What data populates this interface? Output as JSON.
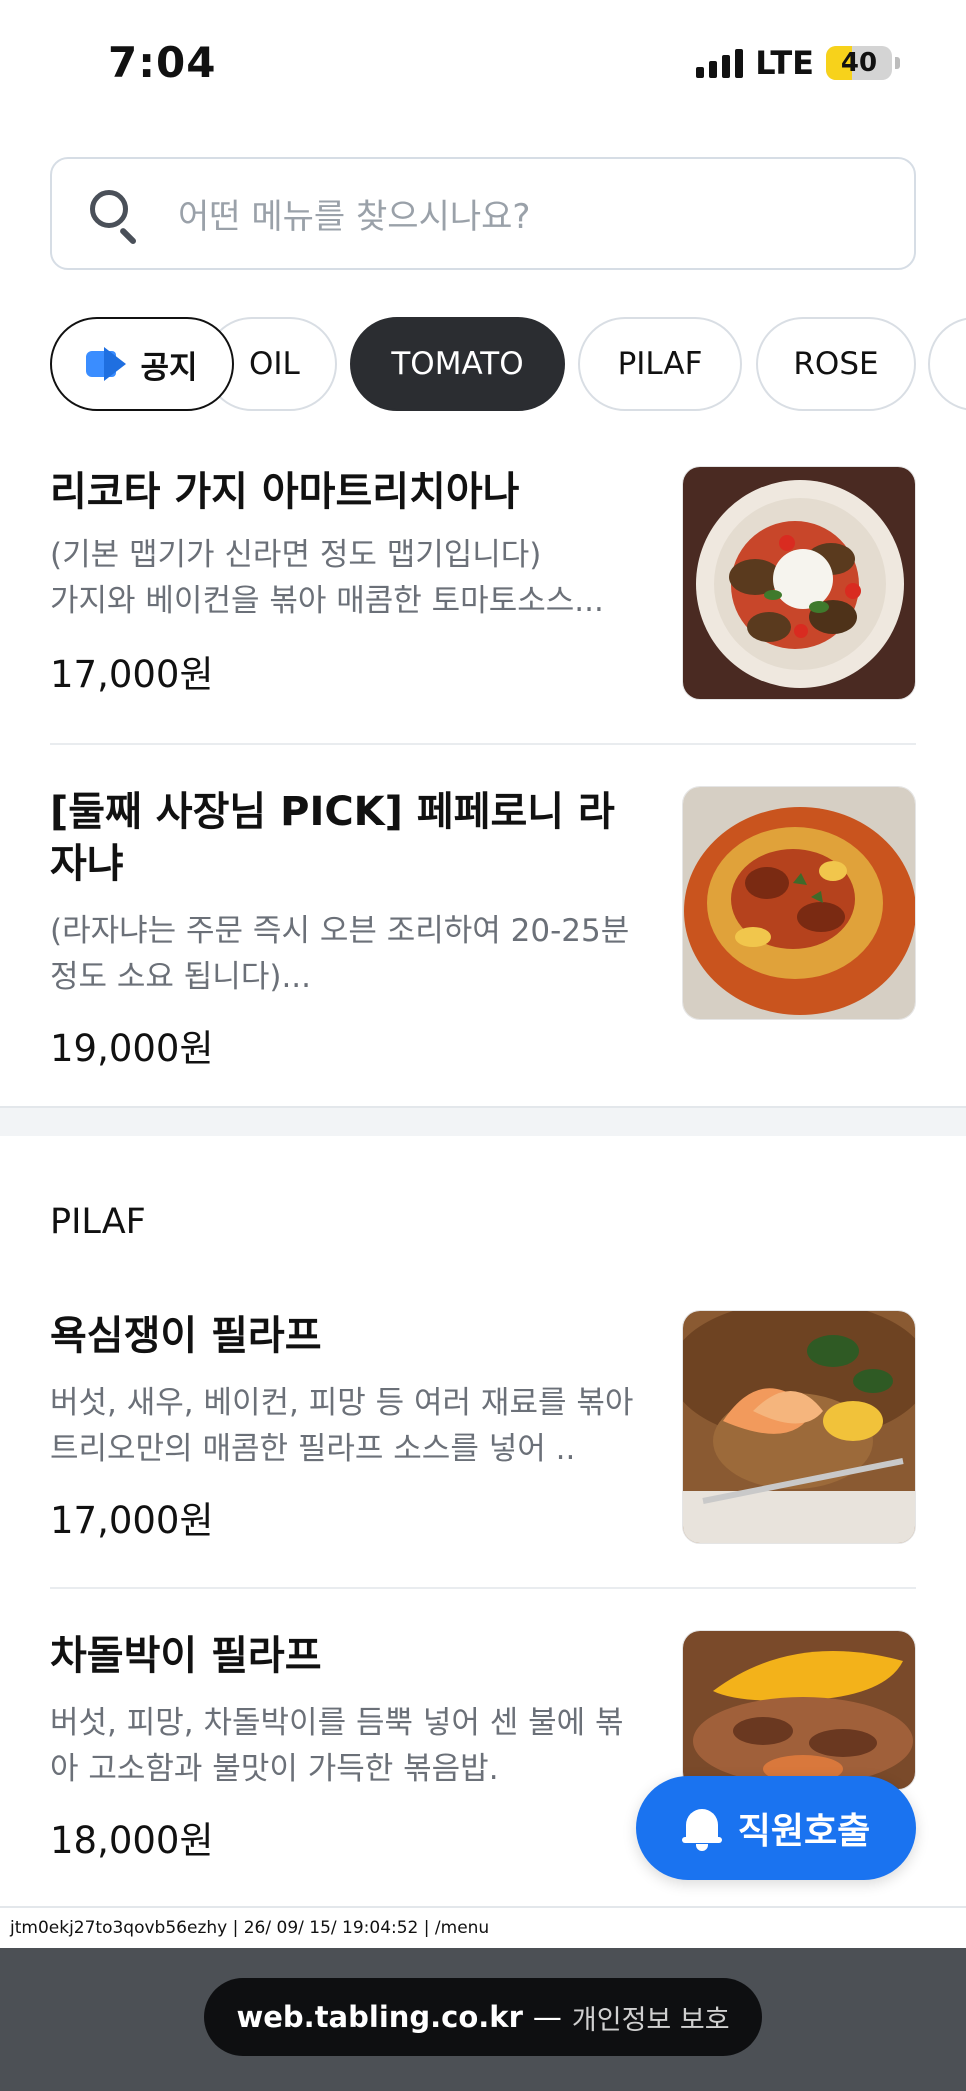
{
  "status_bar": {
    "time": "7:04",
    "network": "LTE",
    "battery": "40",
    "battery_level": 0.4
  },
  "search": {
    "placeholder": "어떤 메뉴를 찾으시나요?"
  },
  "chips": {
    "notice": "공지",
    "items": [
      "OIL",
      "TOMATO",
      "PILAF",
      "ROSE"
    ],
    "active": "TOMATO"
  },
  "tomato_items": [
    {
      "name": "리코타 가지 아마트리치아나",
      "desc": "(기본 맵기가 신라면 정도 맵기입니다)\n가지와 베이컨을 볶아 매콤한 토마토소스...",
      "price": "17,000원"
    },
    {
      "name": "[둘째 사장님 PICK] 페페로니 라자냐",
      "desc": "(라자냐는 주문 즉시 오븐 조리하여 20-25분 정도 소요 됩니다)...",
      "price": "19,000원"
    }
  ],
  "pilaf_section": {
    "title": "PILAF",
    "items": [
      {
        "name": "욕심쟁이 필라프",
        "desc": "버섯, 새우, 베이컨, 피망 등 여러 재료를 볶아 트리오만의 매콤한 필라프 소스를 넣어 ..",
        "price": "17,000원"
      },
      {
        "name": "차돌박이 필라프",
        "desc": "버섯, 피망, 차돌박이를 듬뿍 넣어 센 불에 볶아 고소함과 불맛이 가득한 볶음밥.",
        "price": "18,000원"
      }
    ]
  },
  "call_button": {
    "label": "직원호출"
  },
  "debug_text": "jtm0ekj27to3qovb56ezhy | 26/ 09/ 15/ 19:04:52 | /menu",
  "browser": {
    "host": "web.tabling.co.kr",
    "separator": "—",
    "note": "개인정보 보호"
  },
  "colors": {
    "accent": "#1a73f0",
    "chip_active": "#2b2d31",
    "battery": "#f7d21b"
  }
}
